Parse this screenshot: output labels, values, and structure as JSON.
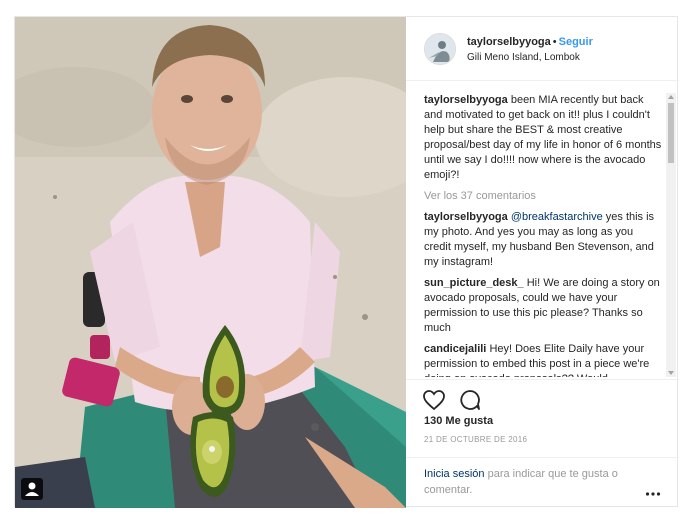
{
  "header": {
    "username": "taylorselbyyoga",
    "separator": "•",
    "follow_label": "Seguir",
    "location": "Gili Meno Island, Lombok"
  },
  "caption": {
    "username": "taylorselbyyoga",
    "text": "been MIA recently but back and motivated to get back on it!! plus I couldn't help but share the BEST & most creative proposal/best day of my life in honor of 6 months until we say I do!!!! now where is the avocado emoji?!"
  },
  "view_all_comments": "Ver los 37 comentarios",
  "comments": [
    {
      "username": "taylorselbyyoga",
      "mention": "@breakfastarchive",
      "text": "yes this is my photo. And yes you may as long as you credit myself, my husband Ben Stevenson, and my instagram!"
    },
    {
      "username": "sun_picture_desk_",
      "mention": "",
      "text": "Hi! We are doing a story on avocado proposals, could we have your permission to use this pic please? Thanks so much"
    },
    {
      "username": "candicejalili",
      "mention": "",
      "text": "Hey! Does Elite Daily have your permission to embed this post in a piece we're doing on avocado proposals?? Would"
    }
  ],
  "likes": "130 Me gusta",
  "date": "21 DE OCTUBRE DE 2016",
  "footer": {
    "login_link": "Inicia sesión",
    "login_rest": "para indicar que te gusta o comentar."
  },
  "icons": {
    "like": "heart-icon",
    "comment": "comment-icon",
    "more": "more-options-icon",
    "user_tag": "user-tag-icon"
  },
  "colors": {
    "link_blue": "#3897f0",
    "dark_link": "#003569",
    "muted": "#999999",
    "text": "#262626"
  }
}
